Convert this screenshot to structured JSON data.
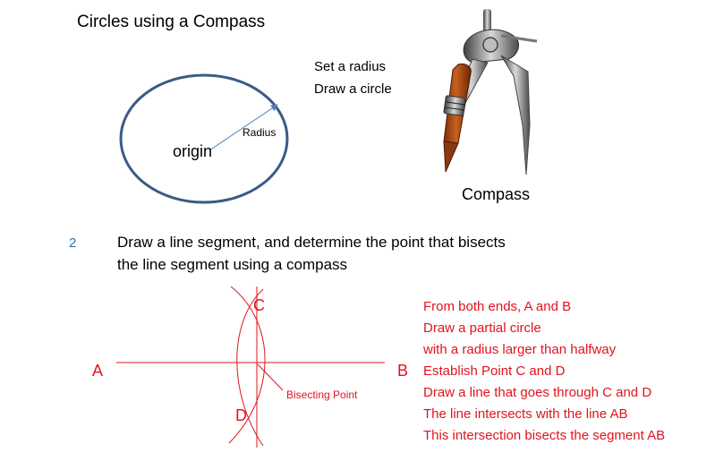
{
  "section1": {
    "title": "Circles using a Compass",
    "instructions": [
      "Set a radius",
      "Draw a circle"
    ],
    "circle_center_label": "origin",
    "radius_label": "Radius",
    "compass_caption": "Compass"
  },
  "section2": {
    "number": "2",
    "heading_lines": [
      "Draw a line segment, and determine the point that bisects",
      "the line segment using a compass"
    ],
    "point_labels": {
      "a": "A",
      "b": "B",
      "c": "C",
      "d": "D"
    },
    "bisecting_label": "Bisecting Point",
    "steps": [
      "From both ends, A and B",
      "Draw a partial circle",
      "with a radius larger than halfway",
      "Establish Point C and D",
      "Draw a line that goes through C and D",
      "The line intersects with the line AB",
      "This intersection bisects the segment AB"
    ]
  },
  "colors": {
    "circle_stroke": "#3b5a86",
    "radius_arrow": "#4f7fc2",
    "construction": "#e0141e",
    "step_number": "#2a6fa8"
  }
}
